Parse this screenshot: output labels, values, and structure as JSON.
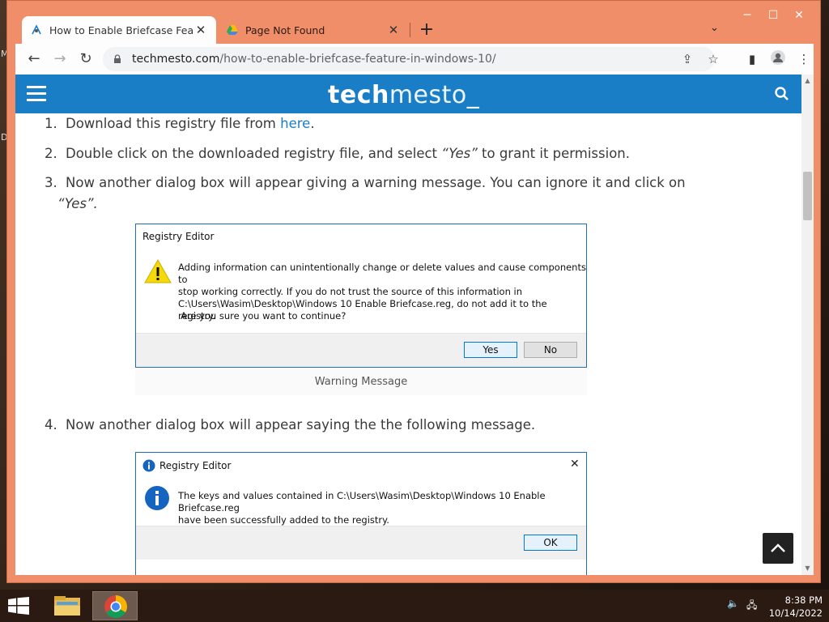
{
  "desktop": {
    "icon_letters": [
      "M",
      "D"
    ]
  },
  "browser": {
    "tabs": [
      {
        "title": "How to Enable Briefcase Feature",
        "active": true
      },
      {
        "title": "Page Not Found",
        "active": false
      }
    ],
    "new_tab_symbol": "+",
    "address": {
      "domain": "techmesto.com",
      "path": "/how-to-enable-briefcase-feature-in-windows-10/"
    }
  },
  "site": {
    "logo_part1": "tech",
    "logo_part2": "mesto_",
    "brand_color": "#1a7ec6"
  },
  "article": {
    "steps": [
      {
        "num": "1.",
        "text": "Download this registry file from ",
        "link": "here",
        "after": "."
      },
      {
        "num": "2.",
        "text": "Double click on the downloaded registry file, and select ",
        "em": "“Yes”",
        "after": " to grant it permission."
      },
      {
        "num": "3.",
        "text": "Now another dialog box will appear giving a warning message. You can ignore it and click on",
        "line2": "“Yes”."
      },
      {
        "num": "4.",
        "text": "Now another dialog box will appear saying the the following message."
      }
    ],
    "caption": "Warning Message"
  },
  "dialog_warning": {
    "title": "Registry Editor",
    "message": "Adding information can unintentionally change or delete values and cause components to stop working correctly. If you do not trust the source of this information in C:\\Users\\Wasim\\Desktop\\Windows 10 Enable Briefcase.reg, do not add it to the registry.",
    "line1": "Adding information can unintentionally change or delete values and cause components to",
    "line2": "stop working correctly. If you do not trust the source of this information in",
    "line3": "C:\\Users\\Wasim\\Desktop\\Windows 10 Enable Briefcase.reg, do not add it to the registry.",
    "question": "Are you sure you want to continue?",
    "yes": "Yes",
    "no": "No"
  },
  "dialog_info": {
    "title": "Registry Editor",
    "line1": "The keys and values contained in C:\\Users\\Wasim\\Desktop\\Windows 10 Enable Briefcase.reg",
    "line2": "have been successfully added to the registry.",
    "ok": "OK"
  },
  "taskbar": {
    "time": "8:38 PM",
    "date": "10/14/2022"
  }
}
